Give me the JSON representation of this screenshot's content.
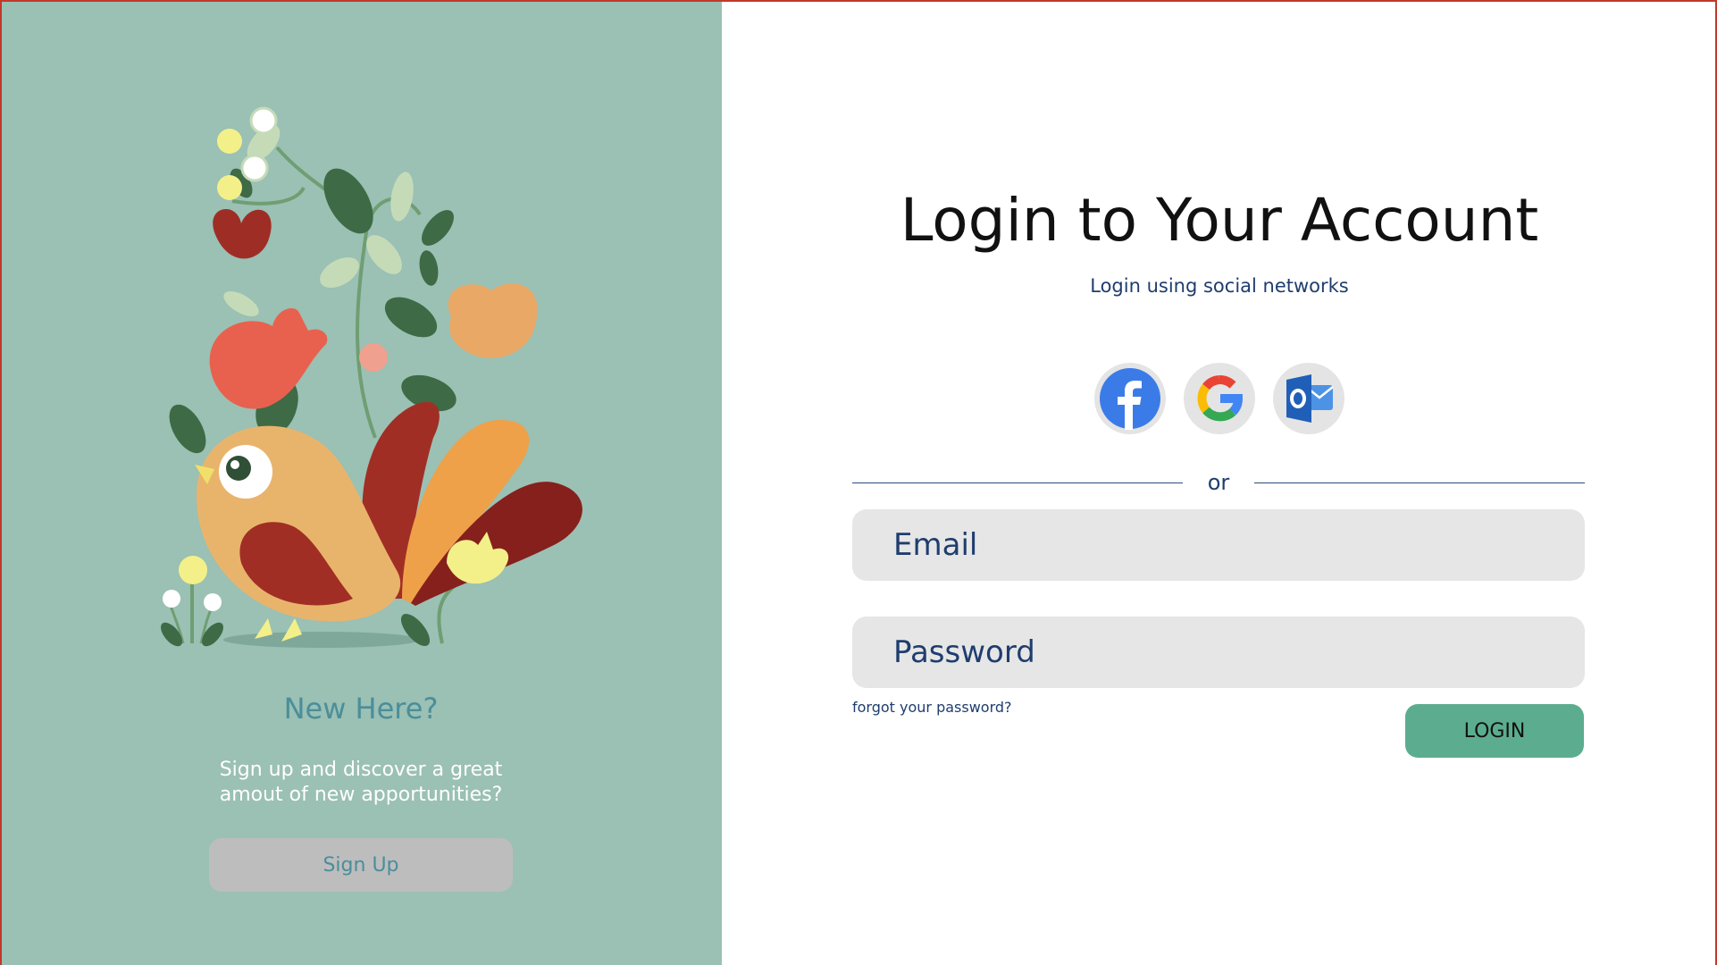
{
  "colors": {
    "left_panel_bg": "#9bc0b4",
    "accent_teal_text": "#4a8e9a",
    "login_button": "#5cad8f",
    "input_bg": "#e6e6e6",
    "navy_text": "#1f3d6e",
    "frame_border": "#c0392b"
  },
  "left": {
    "heading": "New Here?",
    "description_line1": "Sign up and discover a great",
    "description_line2": "amout of new apportunities?",
    "signup_label": "Sign Up",
    "illustration": "bird-and-flowers-illustration"
  },
  "right": {
    "title": "Login to Your Account",
    "subtitle": "Login using social networks",
    "social": [
      {
        "name": "facebook",
        "icon": "facebook-icon"
      },
      {
        "name": "google",
        "icon": "google-icon"
      },
      {
        "name": "outlook",
        "icon": "outlook-icon"
      }
    ],
    "divider_text": "or",
    "email_placeholder": "Email",
    "password_placeholder": "Password",
    "forgot_label": "forgot your password?",
    "login_label": "LOGIN"
  }
}
